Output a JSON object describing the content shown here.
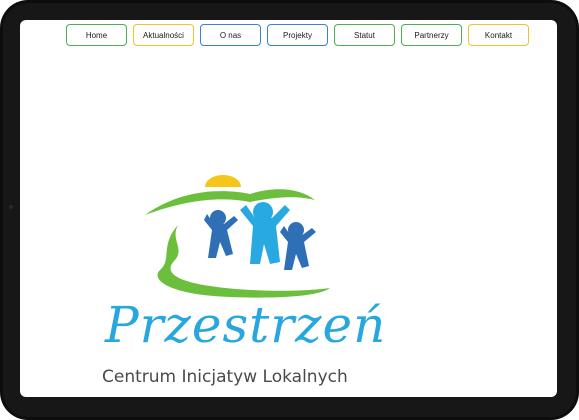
{
  "nav": {
    "items": [
      {
        "label": "Home",
        "color": "#4caf50"
      },
      {
        "label": "Aktualności",
        "color": "#f2c12e"
      },
      {
        "label": "O nas",
        "color": "#3b7fd1"
      },
      {
        "label": "Projekty",
        "color": "#3b7fd1"
      },
      {
        "label": "Statut",
        "color": "#4caf50"
      },
      {
        "label": "Partnerzy",
        "color": "#4caf50"
      },
      {
        "label": "Kontakt",
        "color": "#f2c12e"
      }
    ]
  },
  "logo": {
    "name": "Przestrzeń",
    "subtitle": "Centrum Inicjatyw Lokalnych",
    "colors": {
      "green": "#6cbf3c",
      "blue_light": "#29a9e1",
      "blue_dark": "#2f6fb5",
      "sun": "#f5c518",
      "text_grey": "#4a4a4a"
    }
  }
}
